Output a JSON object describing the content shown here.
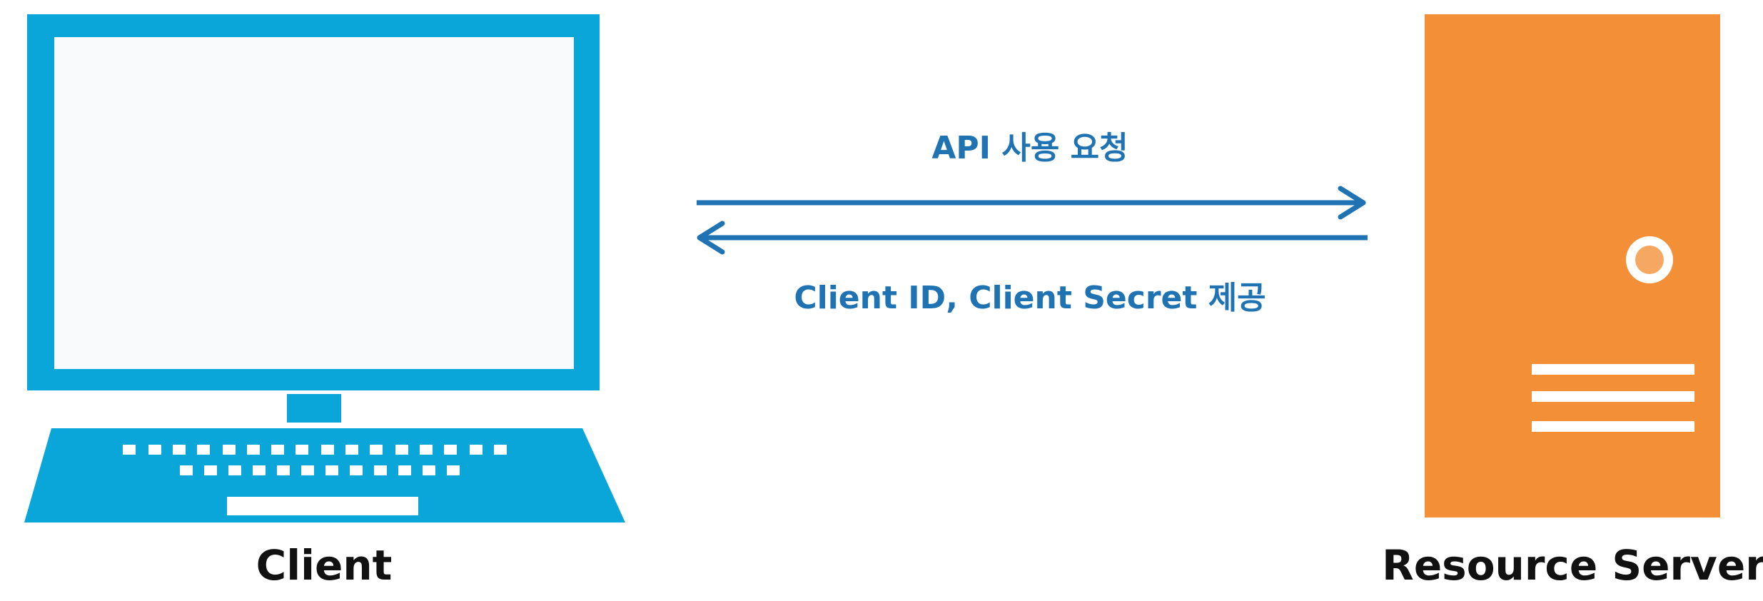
{
  "client": {
    "label": "Client",
    "icon": "desktop-computer-icon"
  },
  "server": {
    "label": "Resource Server",
    "icon": "server-tower-icon"
  },
  "request_arrow": {
    "label": "API 사용 요청"
  },
  "response_arrow": {
    "label": "Client ID, Client Secret 제공"
  },
  "colors": {
    "client_blue": "#0aa5d9",
    "client_screen": "#f8fafc",
    "server_orange": "#f38f37",
    "server_detail": "#ffffff",
    "server_knob_inner": "#f6a862",
    "arrow_blue": "#1f73b3",
    "label_black": "#111111"
  }
}
